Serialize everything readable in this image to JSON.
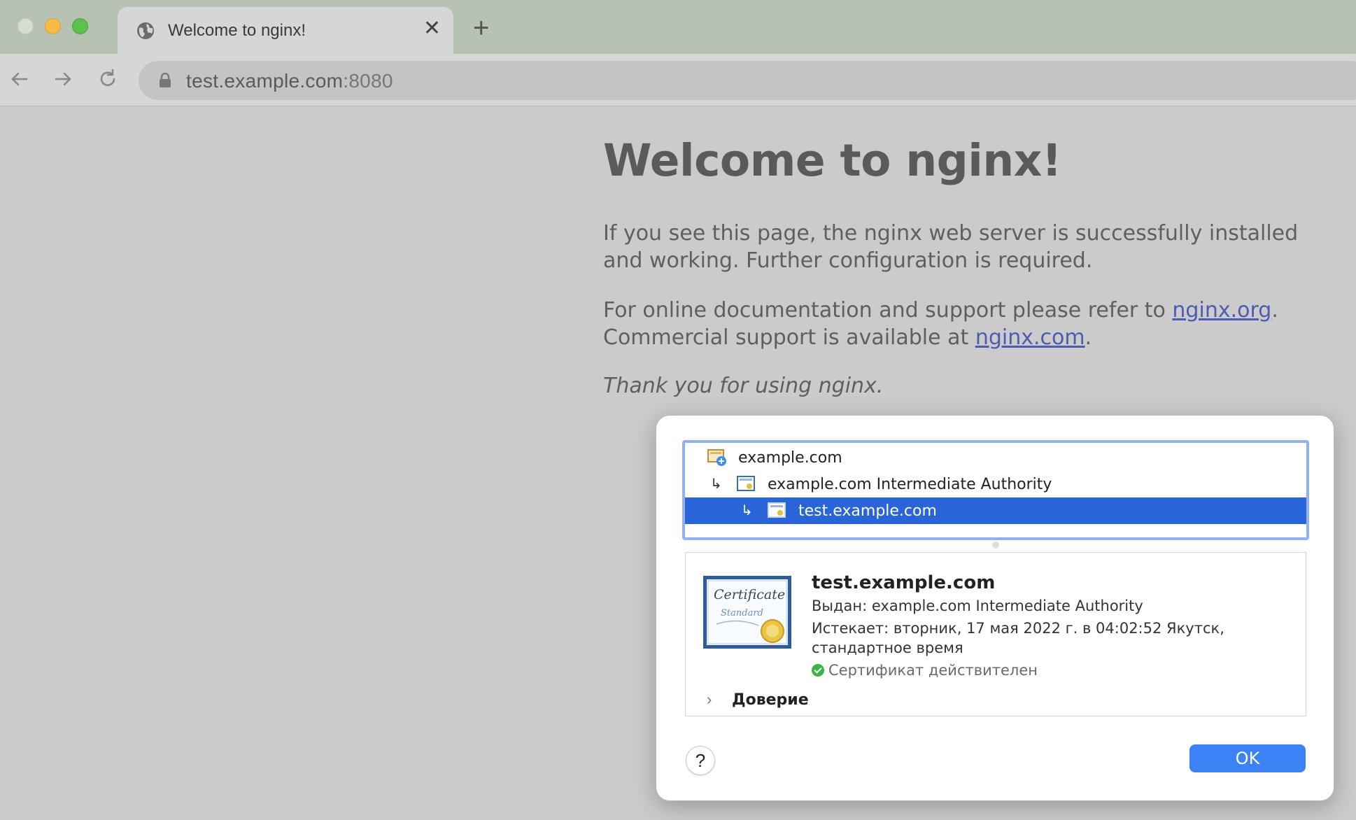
{
  "window": {
    "tab": {
      "title": "Welcome to nginx!",
      "close_glyph": "✕"
    },
    "new_tab_glyph": "+",
    "address_bar": {
      "url_host": "test.example.com",
      "url_port": ":8080"
    }
  },
  "page": {
    "heading": "Welcome to nginx!",
    "para1": "If you see this page, the nginx web server is successfully installed and working. Further configuration is required.",
    "para2_prefix": "For online documentation and support please refer to ",
    "link_org": "nginx.org",
    "para2_mid": ".",
    "para2_line2_prefix": "Commercial support is available at ",
    "link_com": "nginx.com",
    "para2_suffix": ".",
    "thanks": "Thank you for using nginx."
  },
  "cert_dialog": {
    "chain": [
      {
        "label": "example.com",
        "arrow": ""
      },
      {
        "label": "example.com Intermediate Authority",
        "arrow": "↳"
      },
      {
        "label": "test.example.com",
        "arrow": "↳",
        "selected": true
      }
    ],
    "detail": {
      "name": "test.example.com",
      "issued_by": "Выдан: example.com Intermediate Authority",
      "expires": "Истекает: вторник, 17 мая 2022 г. в 04:02:52 Якутск, стандартное время",
      "status": "Сертификат действителен",
      "trust_chevron": "›",
      "trust_label": "Доверие"
    },
    "help_glyph": "?",
    "ok_label": "OK"
  },
  "colors": {
    "selection": "#2a64d9",
    "ok_button": "#3a82f6",
    "link": "#4d5bb3",
    "valid_check": "#39b54a"
  }
}
